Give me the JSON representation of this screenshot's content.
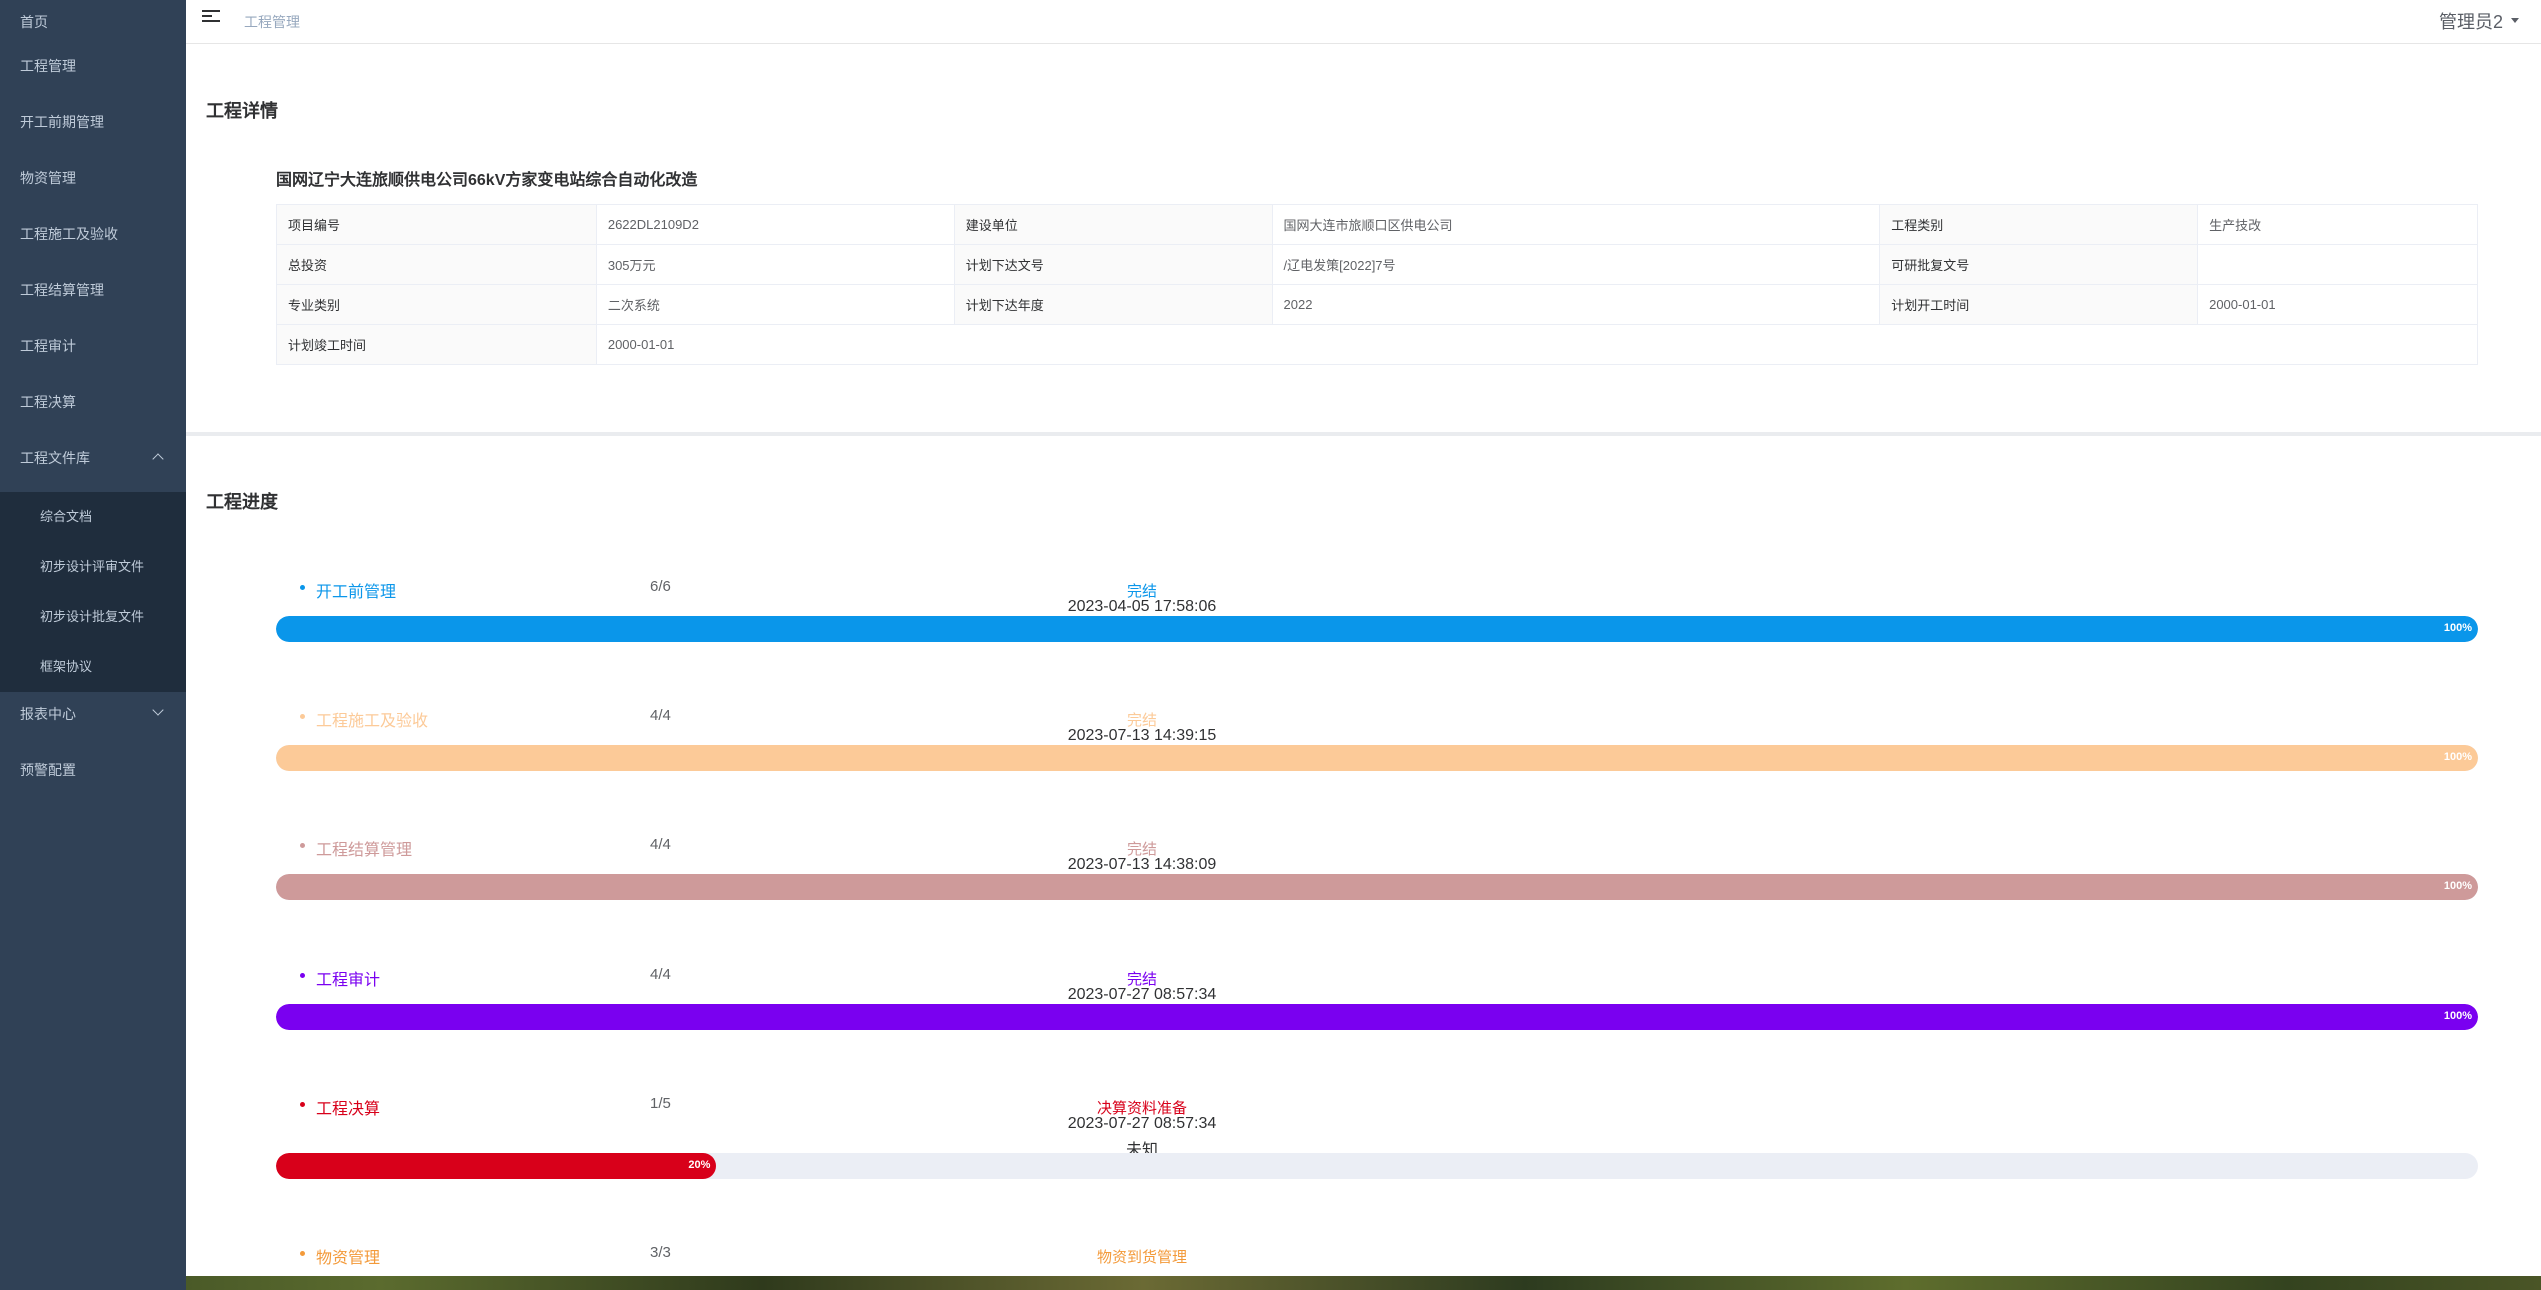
{
  "sidebar": {
    "items": [
      {
        "label": "首页"
      },
      {
        "label": "工程管理"
      },
      {
        "label": "开工前期管理"
      },
      {
        "label": "物资管理"
      },
      {
        "label": "工程施工及验收"
      },
      {
        "label": "工程结算管理"
      },
      {
        "label": "工程审计"
      },
      {
        "label": "工程决算"
      }
    ],
    "library": {
      "label": "工程文件库",
      "children": [
        {
          "label": "综合文档"
        },
        {
          "label": "初步设计评审文件"
        },
        {
          "label": "初步设计批复文件"
        },
        {
          "label": "框架协议"
        }
      ]
    },
    "report": {
      "label": "报表中心"
    },
    "warning": {
      "label": "预警配置"
    }
  },
  "navbar": {
    "breadcrumb": "工程管理",
    "user": "管理员2"
  },
  "detail": {
    "title": "工程详情",
    "project_name": "国网辽宁大连旅顺供电公司66kV方家变电站综合自动化改造",
    "rows": [
      [
        {
          "label": "项目编号",
          "value": "2622DL2109D2"
        },
        {
          "label": "建设单位",
          "value": "国网大连市旅顺口区供电公司"
        },
        {
          "label": "工程类别",
          "value": "生产技改"
        }
      ],
      [
        {
          "label": "总投资",
          "value": "305万元"
        },
        {
          "label": "计划下达文号",
          "value": "/辽电发策[2022]7号"
        },
        {
          "label": "可研批复文号",
          "value": ""
        }
      ],
      [
        {
          "label": "专业类别",
          "value": "二次系统"
        },
        {
          "label": "计划下达年度",
          "value": "2022"
        },
        {
          "label": "计划开工时间",
          "value": "2000-01-01"
        }
      ],
      [
        {
          "label": "计划竣工时间",
          "value": "2000-01-01"
        }
      ]
    ]
  },
  "progress": {
    "title": "工程进度",
    "steps": [
      {
        "name": "开工前管理",
        "count": "6/6",
        "status": "完结",
        "time": "2023-04-05 17:58:06",
        "extra": "",
        "percent": 100,
        "percent_label": "100%",
        "color": "#0a96ea"
      },
      {
        "name": "工程施工及验收",
        "count": "4/4",
        "status": "完结",
        "time": "2023-07-13 14:39:15",
        "extra": "",
        "percent": 100,
        "percent_label": "100%",
        "color": "#fcca98"
      },
      {
        "name": "工程结算管理",
        "count": "4/4",
        "status": "完结",
        "time": "2023-07-13 14:38:09",
        "extra": "",
        "percent": 100,
        "percent_label": "100%",
        "color": "#ce9a9a"
      },
      {
        "name": "工程审计",
        "count": "4/4",
        "status": "完结",
        "time": "2023-07-27 08:57:34",
        "extra": "",
        "percent": 100,
        "percent_label": "100%",
        "color": "#7a00f0"
      },
      {
        "name": "工程决算",
        "count": "1/5",
        "status": "决算资料准备",
        "time": "2023-07-27 08:57:34",
        "extra": "未知",
        "percent": 20,
        "percent_label": "20%",
        "color": "#d8001a"
      },
      {
        "name": "物资管理",
        "count": "3/3",
        "status": "物资到货管理",
        "time": "",
        "extra": "",
        "percent": null,
        "percent_label": "",
        "color": "#f39a3a"
      }
    ]
  }
}
